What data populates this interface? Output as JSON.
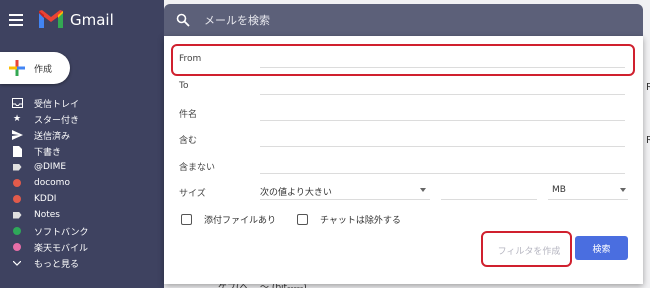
{
  "app": {
    "name": "Gmail"
  },
  "compose": {
    "label": "作成"
  },
  "sidebar": {
    "items": [
      {
        "label": "受信トレイ",
        "icon": "inbox-icon",
        "color": "#ffffff"
      },
      {
        "label": "スター付き",
        "icon": "star-icon",
        "color": "#ffffff"
      },
      {
        "label": "送信済み",
        "icon": "send-icon",
        "color": "#ffffff"
      },
      {
        "label": "下書き",
        "icon": "draft-icon",
        "color": "#ffffff"
      },
      {
        "label": "@DIME",
        "icon": "label-icon",
        "color": "#e0e0e0"
      },
      {
        "label": "docomo",
        "icon": "label-icon",
        "color": "#e25b4b"
      },
      {
        "label": "KDDI",
        "icon": "label-icon",
        "color": "#e25b4b"
      },
      {
        "label": "Notes",
        "icon": "label-icon",
        "color": "#e0e0e0"
      },
      {
        "label": "ソフトバンク",
        "icon": "label-icon",
        "color": "#2ea859"
      },
      {
        "label": "楽天モバイル",
        "icon": "label-icon",
        "color": "#e86ea8"
      },
      {
        "label": "もっと見る",
        "icon": "chevron-down-icon",
        "color": "#ffffff"
      }
    ]
  },
  "search": {
    "placeholder": "メールを検索"
  },
  "filter": {
    "from_label": "From",
    "to_label": "To",
    "subject_label": "件名",
    "includes_label": "含む",
    "excludes_label": "含まない",
    "size_label": "サイズ",
    "size_comparator": "次の値より大きい",
    "size_unit": "MB",
    "has_attachment_label": "添付ファイルあり",
    "exclude_chats_label": "チャットは除外する",
    "create_filter_label": "フィルタを作成",
    "search_button_label": "検索"
  },
  "colors": {
    "highlight": "#d0202e",
    "accent": "#4a6ee0",
    "sidebar_bg": "#3e4260"
  },
  "background": {
    "peek_right_1": "R",
    "peek_right_2": "R",
    "bottom_text": "ゲブ(ヘ... ～ (bit-----)"
  }
}
